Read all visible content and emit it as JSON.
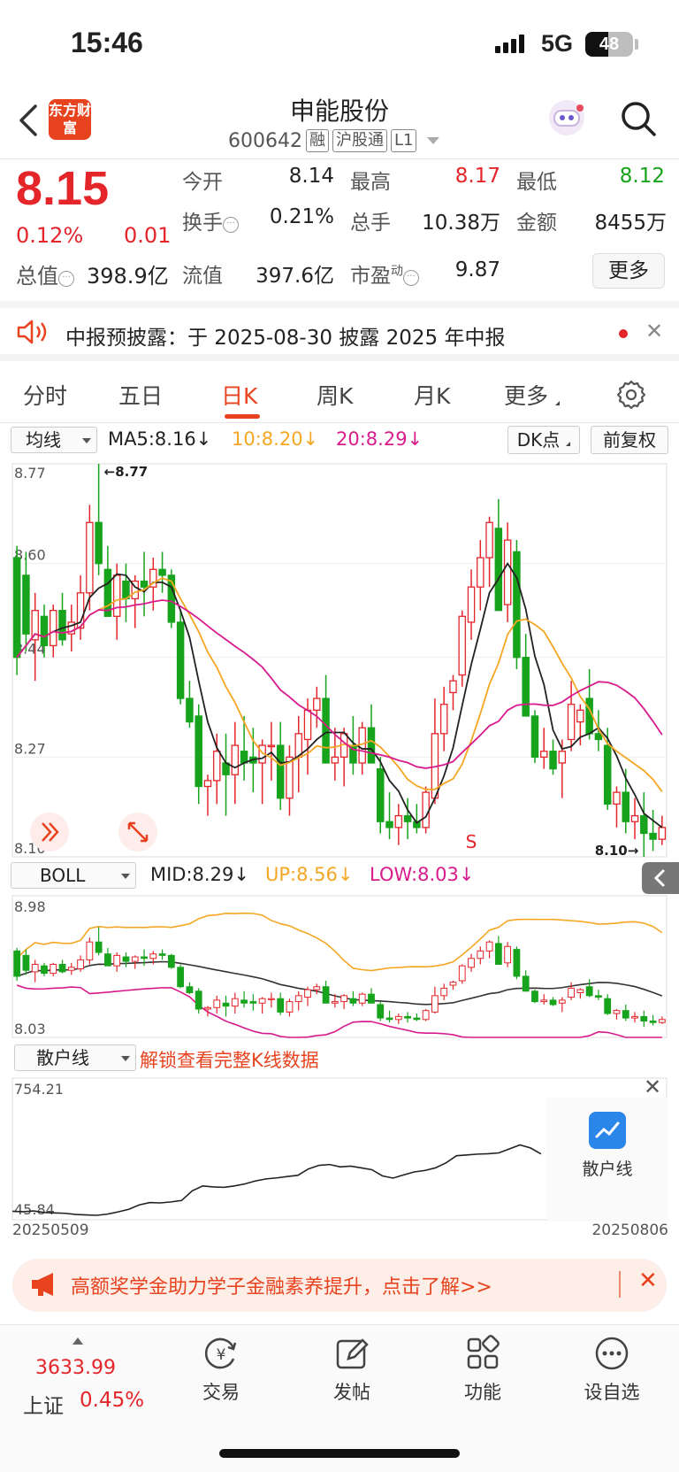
{
  "status": {
    "time": "15:46",
    "network": "5G",
    "battery": "48"
  },
  "nav": {
    "logo_text": "东方财富",
    "stock_name": "申能股份",
    "stock_code": "600642",
    "tags": [
      "融",
      "沪股通",
      "L1"
    ]
  },
  "quote": {
    "price": "8.15",
    "change_pct": "0.12%",
    "change": "0.01",
    "market_value_label": "总值",
    "market_value": "398.9亿",
    "fields": [
      {
        "label": "今开",
        "value": "8.14",
        "color": "normal"
      },
      {
        "label": "最高",
        "value": "8.17",
        "color": "red"
      },
      {
        "label": "最低",
        "value": "8.12",
        "color": "green"
      },
      {
        "label": "换手",
        "value": "0.21%",
        "color": "normal"
      },
      {
        "label": "总手",
        "value": "10.38万",
        "color": "normal"
      },
      {
        "label": "金额",
        "value": "8455万",
        "color": "normal"
      },
      {
        "label": "流值",
        "value": "397.6亿",
        "color": "normal"
      },
      {
        "label": "市盈",
        "value": "9.87",
        "color": "normal"
      }
    ],
    "pe_sup": "动",
    "more_button": "更多"
  },
  "notice": {
    "text": "中报预披露：于 2025-08-30 披露 2025 年中报"
  },
  "tabs": [
    "分时",
    "五日",
    "日K",
    "周K",
    "月K",
    "更多"
  ],
  "active_tab": "日K",
  "ma_row": {
    "selector": "均线",
    "ma5": "MA5:8.16↓",
    "ma10": "10:8.20↓",
    "ma20": "20:8.29↓",
    "dk_button": "DK点",
    "adjust_button": "前复权"
  },
  "boll_row": {
    "selector": "BOLL",
    "mid": "MID:8.29↓",
    "up": "UP:8.56↓",
    "low": "LOW:8.03↓"
  },
  "retail_row": {
    "selector": "散户线",
    "locked_text": "解锁查看完整K线数据",
    "badge_label": "散户线"
  },
  "colors": {
    "up": "#e4262b",
    "down": "#17a31c",
    "ma5": "#222222",
    "ma10": "#f5a623",
    "ma20": "#d81b8c",
    "accent": "#e8431f"
  },
  "chart_data": [
    {
      "type": "candlestick",
      "title": "日K",
      "y_ticks": [
        "8.77",
        "8.60",
        "8.44",
        "8.27",
        "8.10"
      ],
      "ylim": [
        8.1,
        8.77
      ],
      "max_marker": "8.77",
      "min_marker": "8.10",
      "signal_label": "S",
      "ohlc": [
        [
          8.61,
          8.63,
          8.41,
          8.44
        ],
        [
          8.58,
          8.62,
          8.45,
          8.48
        ],
        [
          8.47,
          8.55,
          8.4,
          8.52
        ],
        [
          8.51,
          8.53,
          8.44,
          8.46
        ],
        [
          8.46,
          8.53,
          8.44,
          8.52
        ],
        [
          8.52,
          8.55,
          8.46,
          8.47
        ],
        [
          8.48,
          8.53,
          8.45,
          8.5
        ],
        [
          8.49,
          8.58,
          8.47,
          8.55
        ],
        [
          8.55,
          8.7,
          8.52,
          8.67
        ],
        [
          8.67,
          8.77,
          8.58,
          8.6
        ],
        [
          8.59,
          8.63,
          8.51,
          8.51
        ],
        [
          8.51,
          8.6,
          8.47,
          8.58
        ],
        [
          8.57,
          8.6,
          8.5,
          8.54
        ],
        [
          8.54,
          8.58,
          8.49,
          8.57
        ],
        [
          8.57,
          8.62,
          8.51,
          8.56
        ],
        [
          8.56,
          8.61,
          8.52,
          8.59
        ],
        [
          8.59,
          8.62,
          8.55,
          8.58
        ],
        [
          8.58,
          8.59,
          8.49,
          8.5
        ],
        [
          8.5,
          8.52,
          8.36,
          8.37
        ],
        [
          8.37,
          8.4,
          8.32,
          8.33
        ],
        [
          8.34,
          8.36,
          8.19,
          8.22
        ],
        [
          8.22,
          8.24,
          8.17,
          8.23
        ],
        [
          8.23,
          8.31,
          8.19,
          8.28
        ],
        [
          8.26,
          8.31,
          8.17,
          8.24
        ],
        [
          8.24,
          8.33,
          8.19,
          8.29
        ],
        [
          8.28,
          8.34,
          8.23,
          8.26
        ],
        [
          8.27,
          8.32,
          8.21,
          8.26
        ],
        [
          8.26,
          8.3,
          8.19,
          8.29
        ],
        [
          8.29,
          8.33,
          8.23,
          8.29
        ],
        [
          8.29,
          8.33,
          8.18,
          8.2
        ],
        [
          8.2,
          8.29,
          8.17,
          8.27
        ],
        [
          8.27,
          8.34,
          8.21,
          8.31
        ],
        [
          8.3,
          8.37,
          8.24,
          8.35
        ],
        [
          8.35,
          8.39,
          8.32,
          8.37
        ],
        [
          8.37,
          8.41,
          8.26,
          8.26
        ],
        [
          8.26,
          8.32,
          8.23,
          8.27
        ],
        [
          8.27,
          8.32,
          8.22,
          8.31
        ],
        [
          8.29,
          8.34,
          8.24,
          8.26
        ],
        [
          8.26,
          8.33,
          8.24,
          8.32
        ],
        [
          8.32,
          8.36,
          8.26,
          8.26
        ],
        [
          8.25,
          8.27,
          8.14,
          8.16
        ],
        [
          8.16,
          8.21,
          8.13,
          8.15
        ],
        [
          8.15,
          8.19,
          8.12,
          8.17
        ],
        [
          8.17,
          8.2,
          8.13,
          8.16
        ],
        [
          8.16,
          8.19,
          8.14,
          8.15
        ],
        [
          8.15,
          8.22,
          8.14,
          8.21
        ],
        [
          8.2,
          8.37,
          8.19,
          8.31
        ],
        [
          8.31,
          8.39,
          8.28,
          8.36
        ],
        [
          8.38,
          8.41,
          8.35,
          8.4
        ],
        [
          8.41,
          8.52,
          8.39,
          8.51
        ],
        [
          8.5,
          8.59,
          8.47,
          8.56
        ],
        [
          8.56,
          8.64,
          8.52,
          8.61
        ],
        [
          8.61,
          8.68,
          8.56,
          8.67
        ],
        [
          8.66,
          8.71,
          8.52,
          8.52
        ],
        [
          8.53,
          8.67,
          8.5,
          8.64
        ],
        [
          8.62,
          8.64,
          8.42,
          8.44
        ],
        [
          8.44,
          8.48,
          8.34,
          8.34
        ],
        [
          8.34,
          8.35,
          8.26,
          8.27
        ],
        [
          8.27,
          8.32,
          8.25,
          8.28
        ],
        [
          8.28,
          8.3,
          8.24,
          8.25
        ],
        [
          8.26,
          8.3,
          8.2,
          8.28
        ],
        [
          8.3,
          8.4,
          8.28,
          8.36
        ],
        [
          8.33,
          8.36,
          8.29,
          8.35
        ],
        [
          8.37,
          8.42,
          8.3,
          8.31
        ],
        [
          8.31,
          8.35,
          8.28,
          8.3
        ],
        [
          8.29,
          8.32,
          8.18,
          8.19
        ],
        [
          8.19,
          8.22,
          8.15,
          8.21
        ],
        [
          8.21,
          8.25,
          8.14,
          8.16
        ],
        [
          8.16,
          8.2,
          8.13,
          8.17
        ],
        [
          8.17,
          8.21,
          8.1,
          8.14
        ],
        [
          8.14,
          8.18,
          8.11,
          8.13
        ],
        [
          8.13,
          8.17,
          8.12,
          8.15
        ]
      ]
    },
    {
      "type": "boll",
      "y_ticks": [
        "8.98",
        "8.03"
      ],
      "ylim": [
        8.03,
        8.98
      ],
      "mid": "MID:8.29",
      "up": "UP:8.56",
      "low": "LOW:8.03"
    },
    {
      "type": "line",
      "title": "散户线",
      "y_ticks": [
        "754.21",
        "45.84"
      ],
      "ylim": [
        45.84,
        754.21
      ],
      "x_range": [
        "20250509",
        "20250806"
      ],
      "values": [
        88,
        86,
        90,
        82,
        80,
        78,
        72,
        70,
        68,
        74,
        85,
        98,
        120,
        132,
        130,
        135,
        142,
        190,
        215,
        210,
        208,
        215,
        225,
        240,
        250,
        255,
        262,
        268,
        300,
        318,
        322,
        310,
        314,
        305,
        296,
        265,
        254,
        270,
        285,
        292,
        305,
        330,
        366,
        370,
        374,
        376,
        380,
        400,
        420,
        405,
        375
      ]
    }
  ],
  "banner": {
    "text": "高额奖学金助力学子金融素养提升，点击了解>>"
  },
  "bottom": {
    "index_value": "3633.99",
    "index_name": "上证",
    "index_pct": "0.45%",
    "items": [
      "交易",
      "发帖",
      "功能",
      "设自选"
    ]
  }
}
